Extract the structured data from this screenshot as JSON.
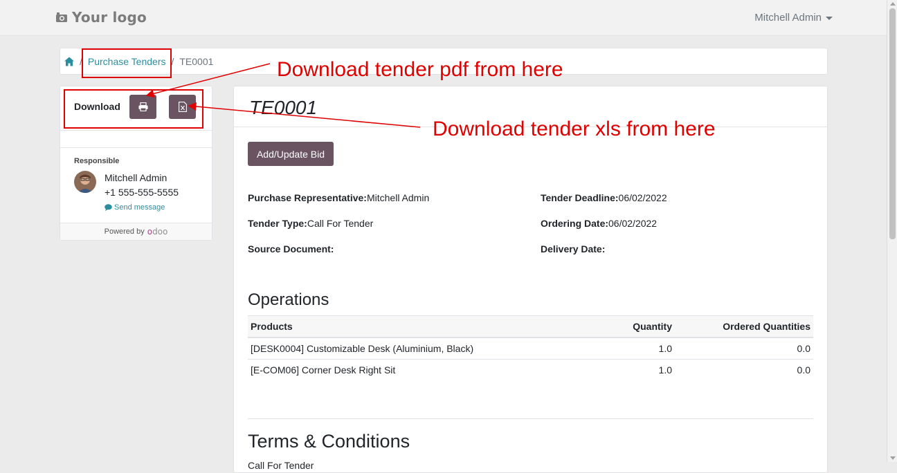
{
  "header": {
    "logo_text": "Your logo",
    "logo_icon": "camera-icon",
    "user_name": "Mitchell Admin"
  },
  "breadcrumb": {
    "home_icon": "home-icon",
    "link": "Purchase Tenders",
    "current": "TE0001"
  },
  "sidebar": {
    "download_label": "Download",
    "print_icon": "print-icon",
    "xls_icon": "excel-file-icon",
    "responsible_label": "Responsible",
    "responsible_name": "Mitchell Admin",
    "responsible_phone": "+1 555-555-5555",
    "send_message": "Send message",
    "powered_by": "Powered by",
    "powered_brand": "odoo"
  },
  "tender": {
    "title": "TE0001",
    "bid_button": "Add/Update Bid",
    "fields": {
      "purchase_rep_label": "Purchase Representative:",
      "purchase_rep_value": "Mitchell Admin",
      "deadline_label": "Tender Deadline:",
      "deadline_value": "06/02/2022",
      "type_label": "Tender Type:",
      "type_value": "Call For Tender",
      "ordering_label": "Ordering Date:",
      "ordering_value": "06/02/2022",
      "source_label": "Source Document:",
      "source_value": "",
      "delivery_label": "Delivery Date:",
      "delivery_value": ""
    },
    "operations_title": "Operations",
    "columns": [
      "Products",
      "Quantity",
      "Ordered Quantities"
    ],
    "rows": [
      {
        "product": "[DESK0004] Customizable Desk (Aluminium, Black)",
        "quantity": "1.0",
        "ordered": "0.0"
      },
      {
        "product": "[E-COM06] Corner Desk Right Sit",
        "quantity": "1.0",
        "ordered": "0.0"
      }
    ],
    "terms_title": "Terms & Conditions",
    "terms_text": "Call For Tender"
  },
  "annotations": {
    "pdf_note": "Download tender pdf from here",
    "xls_note": "Download tender xls from here",
    "color": "#e00000"
  },
  "colors": {
    "primary_button": "#6a5462",
    "link": "#2b8e9e"
  }
}
